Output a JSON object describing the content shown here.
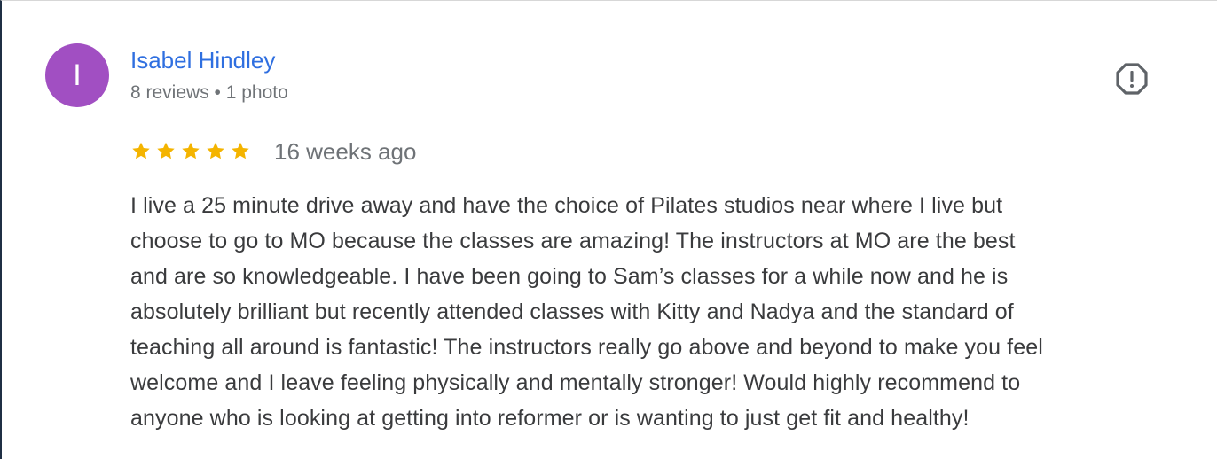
{
  "reviewer": {
    "avatar_letter": "I",
    "avatar_color": "#a14fc2",
    "name": "Isabel Hindley",
    "meta": "8 reviews • 1 photo"
  },
  "review": {
    "rating": 5,
    "time": "16 weeks ago",
    "text": "I live a 25 minute drive away and have the choice of Pilates studios near where I live but\nchoose to go to MO because the classes are amazing! The instructors at MO are the best\nand are so knowledgeable. I have been going to Sam’s classes for a while now and he is\nabsolutely brilliant but recently attended classes with Kitty and Nadya and the standard of\nteaching all around is fantastic! The instructors really go above and beyond to make you feel\nwelcome and I leave feeling physically and mentally stronger! Would highly recommend to\nanyone who is looking at getting into reformer or is wanting to just get fit and healthy!"
  },
  "icons": {
    "report": "report-icon",
    "star": "star-icon"
  },
  "colors": {
    "name_link": "#2f6fe0",
    "star": "#f4b400",
    "secondary_text": "#6f7377",
    "body_text": "#3a3b3d"
  }
}
